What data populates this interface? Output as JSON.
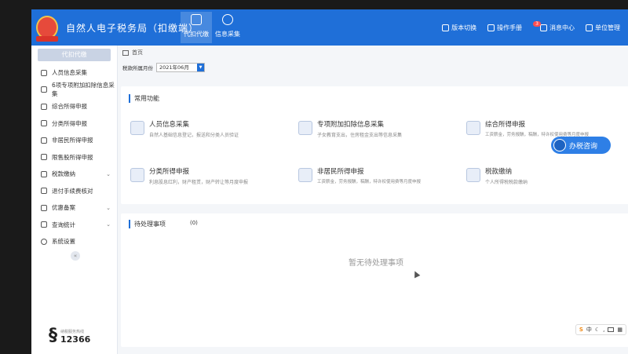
{
  "app": {
    "title": "自然人电子税务局（扣缴端）"
  },
  "top_nav": [
    {
      "label": "代扣代缴",
      "icon": "calculator-icon"
    },
    {
      "label": "信息采集",
      "icon": "database-icon"
    }
  ],
  "top_right": [
    {
      "label": "版本切换",
      "icon": "switch-icon"
    },
    {
      "label": "操作手册",
      "icon": "book-icon"
    },
    {
      "label": "消息中心",
      "icon": "message-icon",
      "badge": "3"
    },
    {
      "label": "单位管理",
      "icon": "building-icon"
    }
  ],
  "sidebar": {
    "home": "代扣代缴",
    "items": [
      {
        "label": "人员信息采集",
        "icon": "user-icon"
      },
      {
        "label": "6项专项附加扣除信息采集",
        "icon": "form-icon"
      },
      {
        "label": "综合所得申报",
        "icon": "report-icon"
      },
      {
        "label": "分类所得申报",
        "icon": "category-icon"
      },
      {
        "label": "非居民所得申报",
        "icon": "person-icon"
      },
      {
        "label": "限售股所得申报",
        "icon": "chart-icon"
      },
      {
        "label": "税款缴纳",
        "icon": "tax-icon",
        "expandable": true
      },
      {
        "label": "退付手续费核对",
        "icon": "refund-icon"
      },
      {
        "label": "优惠备案",
        "icon": "discount-icon",
        "expandable": true
      },
      {
        "label": "查询统计",
        "icon": "query-icon",
        "expandable": true
      },
      {
        "label": "系统设置",
        "icon": "gear-icon"
      }
    ],
    "collapse": "«",
    "hotline_label": "纳税服务热线",
    "hotline_number": "12366"
  },
  "main": {
    "breadcrumb": "首页",
    "period_label": "税款所属月份",
    "period_value": "2021年06月",
    "common_title": "常用功能",
    "functions": [
      {
        "title": "人员信息采集",
        "desc": "自然人基础信息登记，报送和分类人员验证",
        "icon": "id-card-icon"
      },
      {
        "title": "专项附加扣除信息采集",
        "desc": "子女教育支出，住房租金支出等信息采集",
        "icon": "deduction-icon"
      },
      {
        "title": "综合所得申报",
        "desc": "工资薪金，劳务报酬，稿酬，特许权使用费等月度申报",
        "icon": "comprehensive-icon"
      },
      {
        "title": "分类所得申报",
        "desc": "利息股息红利，财产租赁，财产转让等月度申报",
        "icon": "edit-icon"
      },
      {
        "title": "非居民所得申报",
        "desc": "工资薪金，劳务报酬，稿酬，特许权使用费等月度申报",
        "icon": "edit-icon"
      },
      {
        "title": "税款缴纳",
        "desc": "个人所得税税款缴纳",
        "icon": "payment-icon"
      }
    ],
    "consult_label": "办税咨询",
    "todo_title": "待处理事项",
    "todo_count": "(0)",
    "empty_text": "暂无待处理事项"
  },
  "ime": {
    "label": "中"
  }
}
